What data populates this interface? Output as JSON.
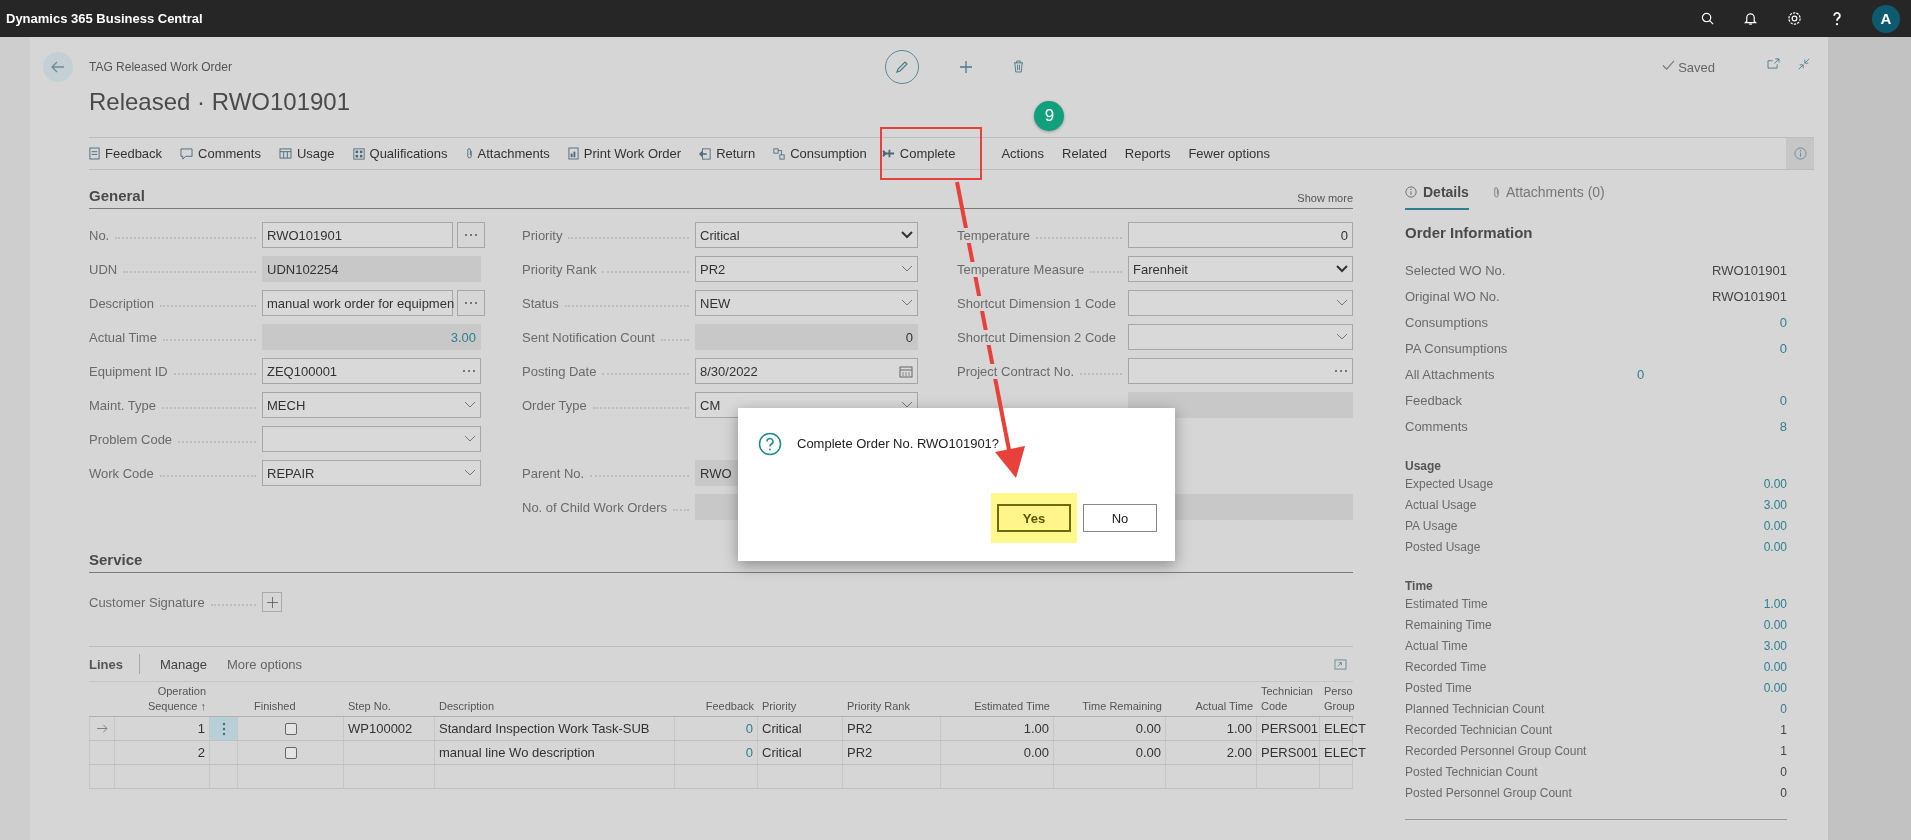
{
  "app_bar": {
    "title": "Dynamics 365 Business Central",
    "avatar": "A"
  },
  "page": {
    "breadcrumb": "TAG Released Work Order",
    "title": "Released · RWO101901",
    "save_status": "Saved"
  },
  "actions": [
    {
      "label": "Feedback",
      "annotated": false
    },
    {
      "label": "Comments",
      "annotated": false
    },
    {
      "label": "Usage",
      "annotated": false
    },
    {
      "label": "Qualifications",
      "annotated": false
    },
    {
      "label": "Attachments",
      "annotated": false
    },
    {
      "label": "Print Work Order",
      "annotated": false
    },
    {
      "label": "Return",
      "annotated": false
    },
    {
      "label": "Consumption",
      "annotated": false
    },
    {
      "label": "Complete",
      "annotated": true
    },
    {
      "label": "Actions",
      "annotated": false
    },
    {
      "label": "Related",
      "annotated": false
    },
    {
      "label": "Reports",
      "annotated": false
    },
    {
      "label": "Fewer options",
      "annotated": false
    }
  ],
  "step_badge": "9",
  "general": {
    "title": "General",
    "show_more": "Show more",
    "columns": [
      [
        {
          "label": "No.",
          "value": "RWO101901",
          "kind": "text-button"
        },
        {
          "label": "UDN",
          "value": "UDN102254",
          "kind": "readonly"
        },
        {
          "label": "Description",
          "value": "manual work order for equipmen",
          "kind": "text-button"
        },
        {
          "label": "Actual Time",
          "value": "3.00",
          "kind": "drilldown"
        },
        {
          "label": "Equipment ID",
          "value": "ZEQ100001",
          "kind": "assist"
        },
        {
          "label": "Maint. Type",
          "value": "MECH",
          "kind": "dropdown"
        },
        {
          "label": "Problem Code",
          "kind": "dropdown"
        },
        {
          "label": "Work Code",
          "value": "REPAIR",
          "kind": "dropdown"
        }
      ],
      [
        {
          "label": "Priority",
          "value": "Critical",
          "kind": "select"
        },
        {
          "label": "Priority Rank",
          "value": "PR2",
          "kind": "dropdown"
        },
        {
          "label": "Status",
          "value": "NEW",
          "kind": "dropdown"
        },
        {
          "label": "Sent Notification Count",
          "value": "0",
          "kind": "readonly-number"
        },
        {
          "label": "Posting Date",
          "value": "8/30/2022",
          "kind": "date"
        },
        {
          "label": "Order Type",
          "value": "CM",
          "kind": "dropdown"
        },
        {
          "kind": "gap"
        },
        {
          "label": "Parent No.",
          "value": "RWO",
          "kind": "readonly"
        },
        {
          "label": "No. of Child Work Orders",
          "kind": "readonly"
        }
      ],
      [
        {
          "label": "Temperature",
          "value": "0",
          "kind": "number"
        },
        {
          "label": "Temperature Measure",
          "value": "Farenheit",
          "kind": "select"
        },
        {
          "label": "Shortcut Dimension 1 Code",
          "kind": "dropdown"
        },
        {
          "label": "Shortcut Dimension 2 Code",
          "kind": "dropdown"
        },
        {
          "label": "Project Contract No.",
          "kind": "assist"
        },
        {
          "kind": "readonly"
        },
        {
          "kind": "gap"
        },
        {
          "kind": "gap"
        },
        {
          "kind": "readonly"
        }
      ]
    ]
  },
  "service": {
    "title": "Service",
    "field_label": "Customer Signature"
  },
  "lines": {
    "title": "Lines",
    "actions": [
      "Manage",
      "More options"
    ],
    "columns": [
      "Operation Sequence ↑",
      "Finished",
      "Step No.",
      "Description",
      "Feedback",
      "Priority",
      "Priority Rank",
      "Estimated Time",
      "Time Remaining",
      "Actual Time",
      "Technician Code",
      "Perso Group"
    ],
    "rows": [
      {
        "selected": true,
        "sequence": "1",
        "finished": false,
        "step": "WP100002",
        "description": "Standard Inspection Work Task-SUB",
        "feedback": "0",
        "priority": "Critical",
        "rank": "PR2",
        "estimated": "1.00",
        "remaining": "0.00",
        "actual": "1.00",
        "technician": "PERS001",
        "group": "ELECT"
      },
      {
        "selected": false,
        "sequence": "2",
        "finished": false,
        "description": "manual line Wo description",
        "feedback": "0",
        "priority": "Critical",
        "rank": "PR2",
        "estimated": "0.00",
        "remaining": "0.00",
        "actual": "2.00",
        "technician": "PERS001",
        "group": "ELECT"
      }
    ]
  },
  "details": {
    "tabs": [
      {
        "label": "Details",
        "selected": true
      },
      {
        "label": "Attachments (0)",
        "selected": false
      }
    ],
    "heading": "Order Information",
    "rows": [
      {
        "label": "Selected WO No.",
        "value": "RWO101901",
        "link": false
      },
      {
        "label": "Original WO No.",
        "value": "RWO101901",
        "link": false
      },
      {
        "label": "Consumptions",
        "value": "0",
        "link": true
      },
      {
        "label": "PA Consumptions",
        "value": "0",
        "link": true
      },
      {
        "label": "All Attachments",
        "value": "0",
        "link": true,
        "kind": "mid"
      },
      {
        "label": "Feedback",
        "value": "0",
        "link": true
      },
      {
        "label": "Comments",
        "value": "8",
        "link": true
      }
    ],
    "groups": [
      {
        "title": "Usage",
        "rows": [
          {
            "label": "Expected Usage",
            "value": "0.00",
            "link": true
          },
          {
            "label": "Actual Usage",
            "value": "3.00",
            "link": true
          },
          {
            "label": "PA Usage",
            "value": "0.00",
            "link": true
          },
          {
            "label": "Posted Usage",
            "value": "0.00",
            "link": true
          }
        ]
      },
      {
        "title": "Time",
        "rows": [
          {
            "label": "Estimated Time",
            "value": "1.00",
            "link": true
          },
          {
            "label": "Remaining Time",
            "value": "0.00",
            "link": true
          },
          {
            "label": "Actual Time",
            "value": "3.00",
            "link": true
          },
          {
            "label": "Recorded Time",
            "value": "0.00",
            "link": true
          },
          {
            "label": "Posted Time",
            "value": "0.00",
            "link": true
          },
          {
            "label": "Planned Technician Count",
            "value": "0",
            "link": true
          },
          {
            "label": "Recorded Technician Count",
            "value": "1",
            "link": false
          },
          {
            "label": "Recorded Personnel Group Count",
            "value": "1",
            "link": false
          },
          {
            "label": "Posted Technician Count",
            "value": "0",
            "link": false
          },
          {
            "label": "Posted Personnel Group Count",
            "value": "0",
            "link": false
          }
        ]
      }
    ]
  },
  "dialog": {
    "message": "Complete Order No. RWO101901?",
    "buttons": [
      {
        "label": "Yes",
        "highlighted": true
      },
      {
        "label": "No",
        "highlighted": false
      }
    ]
  }
}
